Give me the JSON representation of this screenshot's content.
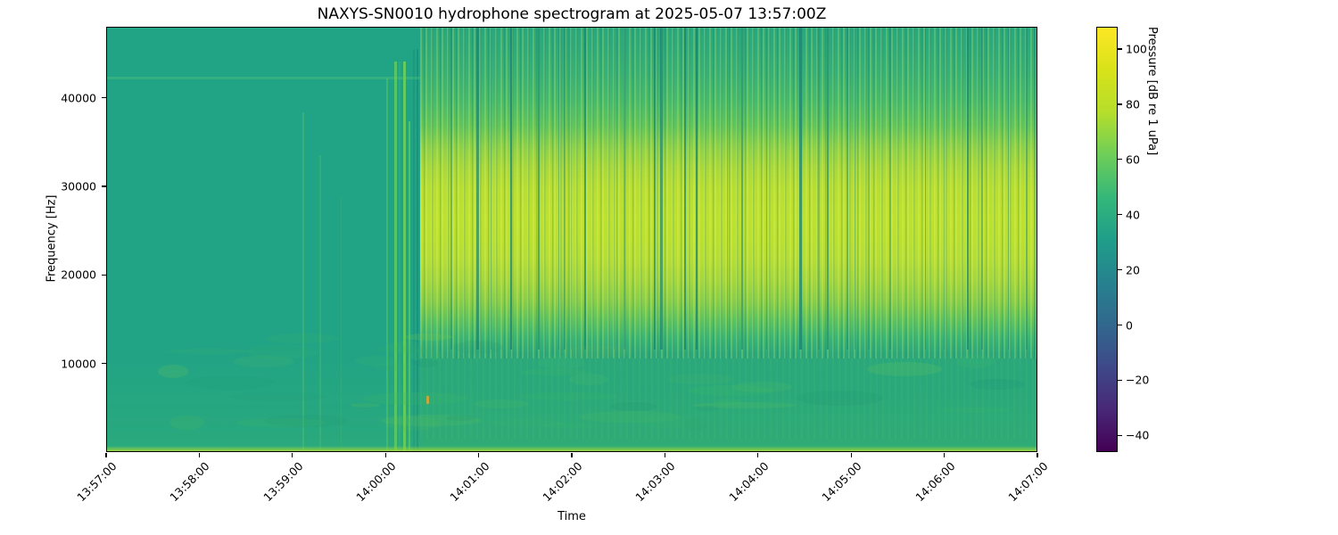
{
  "figure": {
    "title": "NAXYS-SN0010 hydrophone spectrogram at 2025-05-07 13:57:00Z",
    "xlabel": "Time",
    "ylabel": "Frequency [Hz]",
    "colorbar_label": "Pressure [dB re 1 uPa]"
  },
  "chart_data": {
    "type": "heatmap",
    "title": "NAXYS-SN0010 hydrophone spectrogram at 2025-05-07 13:57:00Z",
    "xlabel": "Time",
    "ylabel": "Frequency [Hz]",
    "x_ticks": [
      "13:57:00",
      "13:58:00",
      "13:59:00",
      "14:00:00",
      "14:01:00",
      "14:02:00",
      "14:03:00",
      "14:04:00",
      "14:05:00",
      "14:06:00",
      "14:07:00"
    ],
    "x_range": [
      "13:57:00",
      "14:07:00"
    ],
    "y_ticks_hz": [
      10000,
      20000,
      30000,
      40000
    ],
    "y_tick_labels": [
      "10000",
      "20000",
      "30000",
      "40000"
    ],
    "y_range_hz": [
      0,
      48000
    ],
    "colormap": "viridis",
    "colorbar": {
      "label": "Pressure [dB re 1 uPa]",
      "tick_values": [
        100,
        80,
        60,
        40,
        20,
        0,
        -20,
        -40
      ],
      "tick_labels": [
        "100",
        "80",
        "60",
        "40",
        "20",
        "0",
        "−20",
        "−40"
      ],
      "value_range_db": [
        -46,
        108
      ]
    },
    "features": {
      "ambient_background_level_db": 35,
      "low_frequency_texture_band_hz": [
        0,
        12000
      ],
      "faint_tonal_line_hz": 42500,
      "pre_onset_transient_streaks": [
        "13:59:05",
        "13:59:16",
        "14:00:00",
        "14:00:05",
        "14:00:10",
        "14:00:16"
      ],
      "loud_broadband_event": {
        "onset_time": "14:00:21",
        "end_time": "14:07:00",
        "full_band_hz": [
          12000,
          48000
        ],
        "peak_band_hz": [
          18000,
          32000
        ],
        "approx_peak_level_db": 95,
        "texture": "dense vertical striping with periodic dark dropout lines"
      }
    },
    "quiet_streaks": [
      {
        "x": 219,
        "w": 1.5,
        "color": "rgba(80,195,110,0.45)",
        "top_pct": 20
      },
      {
        "x": 238,
        "w": 1.5,
        "color": "rgba(80,195,110,0.35)",
        "top_pct": 30
      },
      {
        "x": 262,
        "w": 1.0,
        "color": "rgba(80,195,110,0.20)",
        "top_pct": 40
      },
      {
        "x": 313,
        "w": 2.0,
        "color": "rgba(85,200,100,0.55)",
        "top_pct": 12
      },
      {
        "x": 322,
        "w": 3.0,
        "color": "rgba(95,205,95,0.85)",
        "top_pct": 8
      },
      {
        "x": 327,
        "w": 2.0,
        "color": "rgba(60,180,120,0.40)",
        "top_pct": 8
      },
      {
        "x": 332,
        "w": 3.0,
        "color": "rgba(105,210,90,0.90)",
        "top_pct": 8
      },
      {
        "x": 338,
        "w": 2.0,
        "color": "rgba(95,205,95,0.70)",
        "top_pct": 22
      },
      {
        "x": 343,
        "w": 2.0,
        "color": "rgba(30,150,122,0.80)",
        "top_pct": 5
      },
      {
        "x": 347,
        "w": 2.0,
        "color": "rgba(26,143,118,0.80)",
        "top_pct": 5
      }
    ],
    "colors": {
      "background": "#ffffff",
      "text": "#000000",
      "ambient_teal": "#21a385",
      "loud_core_yellow": "#bde031",
      "dark_dropout_line": "#157f6e",
      "viridis_top": "#fde725",
      "viridis_bottom": "#440154"
    }
  }
}
